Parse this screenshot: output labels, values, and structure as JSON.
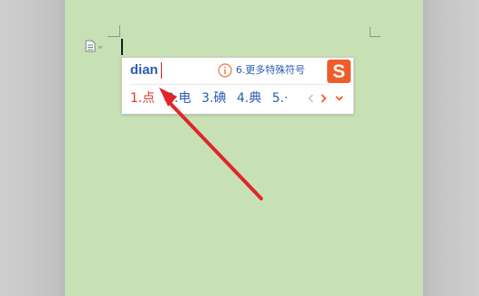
{
  "ime": {
    "pinyin": "dian",
    "more_symbols": "6.更多特殊符号",
    "candidates": [
      "1.点",
      "2.电",
      "3.碘",
      "4.典",
      "5.·"
    ],
    "logo_letter": "S"
  },
  "colors": {
    "page": "#c7e1b5",
    "margin": "#c6c6c6",
    "candidate_selected": "#d83a2b",
    "candidate": "#2a5db0",
    "brand": "#f25c2a",
    "annotation_arrow": "#e0262a"
  },
  "icons": {
    "doc": "document-icon",
    "dropdown": "chevron-down-icon",
    "info": "info-icon",
    "prev": "chevron-left-icon",
    "next": "chevron-right-icon",
    "expand": "chevron-down-icon",
    "logo": "sogou-logo"
  }
}
